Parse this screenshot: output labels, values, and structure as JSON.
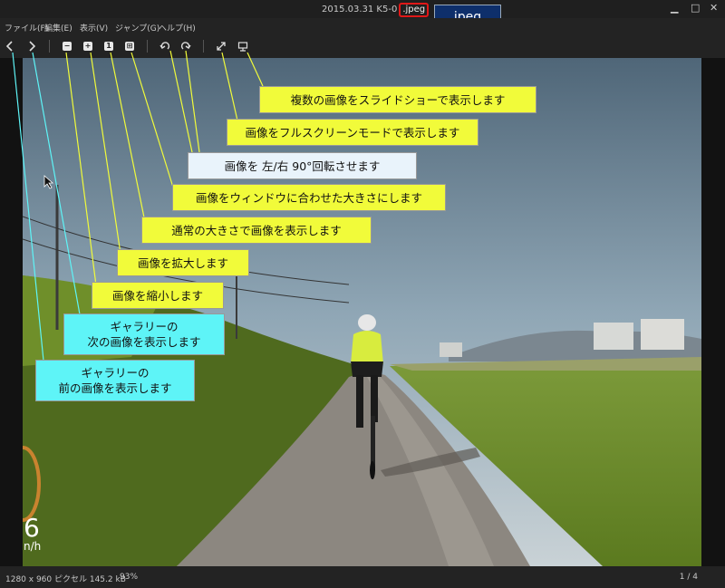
{
  "window": {
    "title_main": "2015.03.31 K5-0",
    "title_ext": ".jpeg",
    "jpeg_callout": "jpeg"
  },
  "menu": [
    "ファイル(F)",
    "編集(E)",
    "表示(V)",
    "ジャンプ(G)",
    "ヘルプ(H)"
  ],
  "toolbar": {
    "prev_icon": "chevron-left-icon",
    "next_icon": "chevron-right-icon",
    "zoom_out_icon": "minus-icon",
    "zoom_in_icon": "plus-icon",
    "actual_size_label": "1",
    "fit_icon": "fit-window-icon",
    "rotate_left_icon": "rotate-left-icon",
    "rotate_right_icon": "rotate-right-icon",
    "fullscreen_icon": "expand-icon",
    "slideshow_icon": "slideshow-icon"
  },
  "overlay": {
    "speed_digit": "6",
    "speed_unit": "n/h"
  },
  "callouts": {
    "slideshow": "複数の画像をスライドショーで表示します",
    "fullscreen": "画像をフルスクリーンモードで表示します",
    "rotate": "画像を 左/右 90°回転させます",
    "fit": "画像をウィンドウに合わせた大きさにします",
    "actual": "通常の大きさで画像を表示します",
    "zoom_in": "画像を拡大します",
    "zoom_out": "画像を縮小します",
    "next_line1": "ギャラリーの",
    "next_line2": "次の画像を表示します",
    "prev_line1": "ギャラリーの",
    "prev_line2": "前の画像を表示します"
  },
  "status": {
    "dimensions": "1280 x 960 ピクセル 145.2 kB",
    "zoom": "93%",
    "page": "1 / 4"
  },
  "colors": {
    "yellow_callout": "#f1fb3a",
    "light_callout": "#e9f3fb",
    "cyan_callout": "#5ef4f7",
    "title_highlight": "#e01818",
    "jpeg_label_bg": "#0e2f6b"
  }
}
